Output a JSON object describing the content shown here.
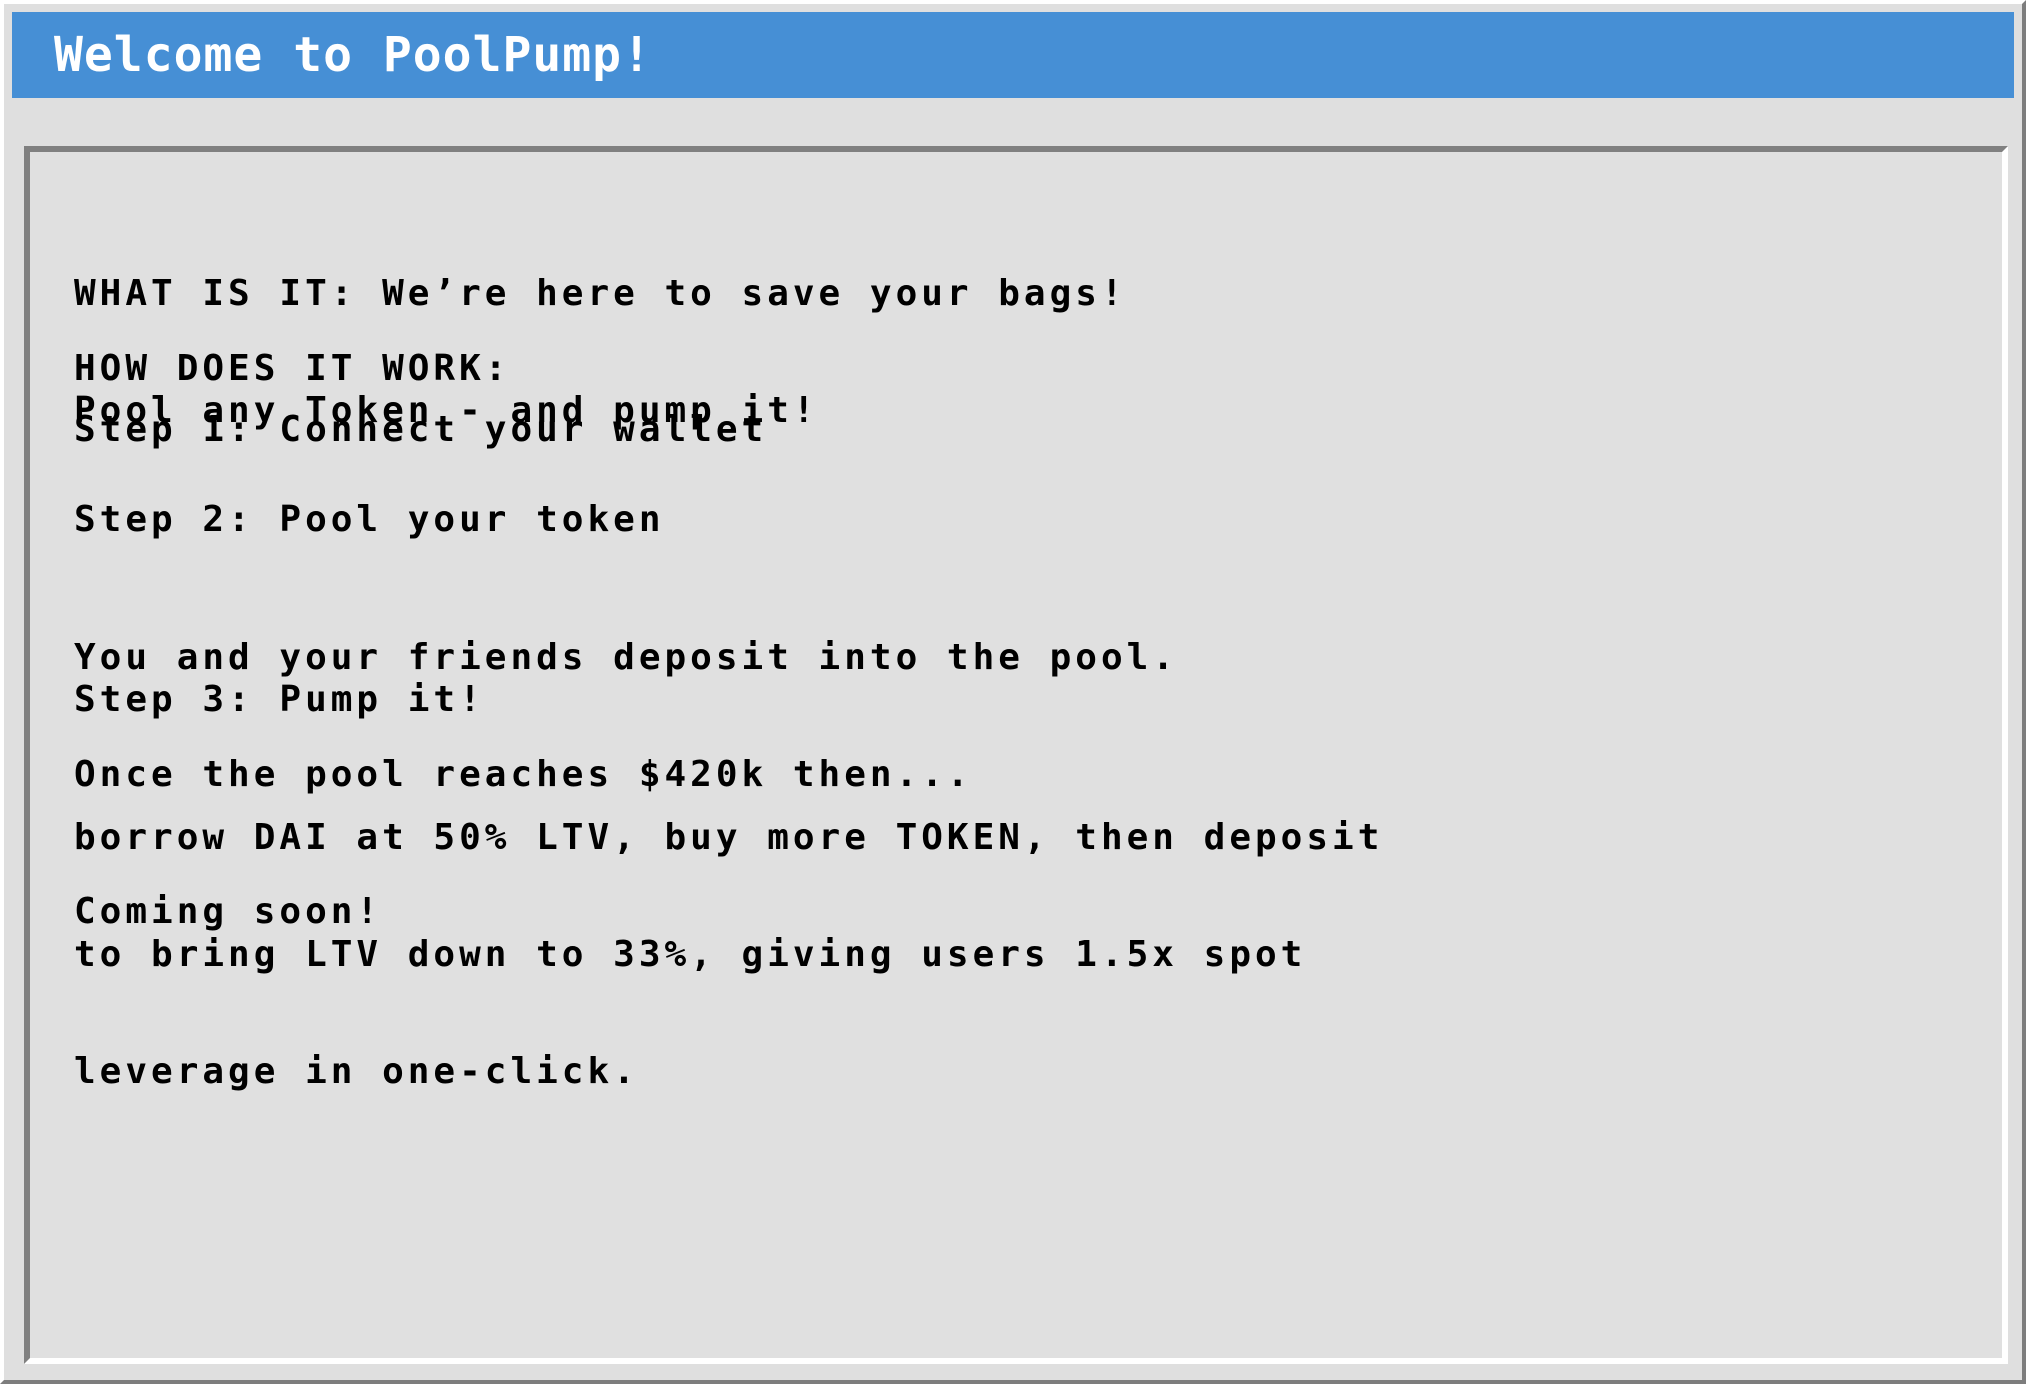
{
  "window": {
    "title": "Welcome to PoolPump!"
  },
  "content": {
    "what_is_it": [
      "WHAT IS IT: We’re here to save your bags!",
      "Pool any Token - and pump it!"
    ],
    "how_heading": "HOW DOES IT WORK:",
    "step1": "Step 1: Connect your wallet",
    "step2": "Step 2: Pool your token",
    "step2_desc": [
      "You and your friends deposit into the pool.",
      "Once the pool reaches $420k then..."
    ],
    "step3": "Step 3: Pump it!",
    "step3_desc": [
      "borrow DAI at 50% LTV, buy more TOKEN, then deposit",
      "to bring LTV down to 33%, giving users 1.5x spot",
      "leverage in one-click."
    ],
    "coming_soon": "Coming soon!"
  },
  "colors": {
    "titlebar": "#468fd5",
    "background": "#dfdfdf",
    "text": "#000000",
    "title_text": "#ffffff"
  }
}
